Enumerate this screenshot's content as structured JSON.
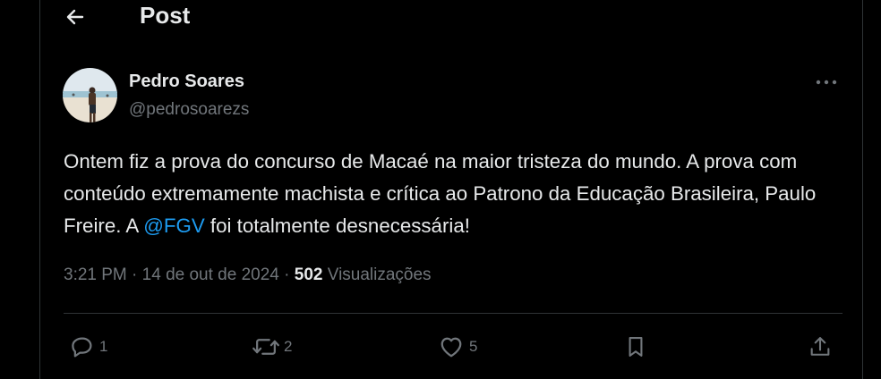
{
  "header": {
    "title": "Post",
    "back_icon": "arrow-left-icon"
  },
  "author": {
    "name": "Pedro Soares",
    "handle": "@pedrosoarezs"
  },
  "post": {
    "text_before": "Ontem fiz a prova do concurso de Macaé na maior tristeza do mundo. A prova com conteúdo extremamente machista e crítica ao Patrono da Educação Brasileira, Paulo Freire. A ",
    "mention": "@FGV",
    "text_after": " foi totalmente desnecessária!"
  },
  "meta": {
    "time": "3:21 PM",
    "separator": "·",
    "date": "14 de out de 2024",
    "views_count": "502",
    "views_label": "Visualizações"
  },
  "actions": {
    "reply_count": "1",
    "repost_count": "2",
    "like_count": "5"
  },
  "colors": {
    "background": "#000000",
    "text": "#e7e9ea",
    "muted": "#71767b",
    "link": "#1d9bf0",
    "border": "#2f3336"
  }
}
